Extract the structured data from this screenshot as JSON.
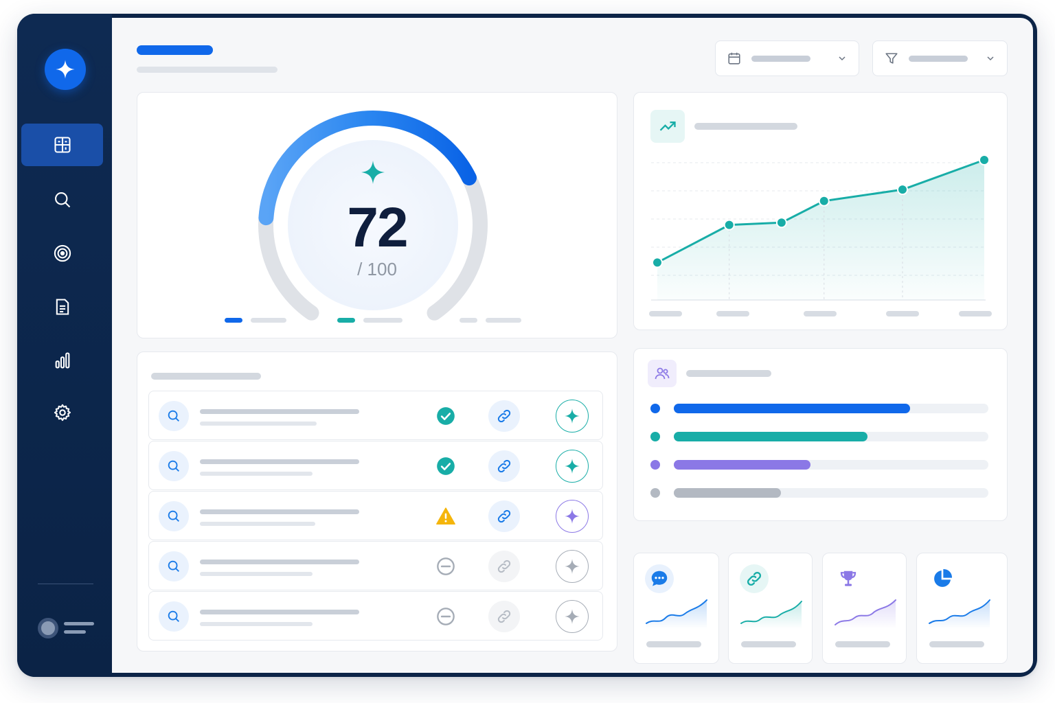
{
  "gauge": {
    "score": "72",
    "max": "/ 100",
    "value": 0.72
  },
  "colors": {
    "primary": "#1068ea",
    "teal": "#18ada7",
    "purple": "#8b78e6",
    "gray": "#b3b9c2",
    "sidebar": "#0c2447",
    "warning": "#f5b50a"
  },
  "sidebar": {
    "logo_icon": "sparkle-icon",
    "items": [
      {
        "name": "dashboard",
        "icon": "dashboard-icon",
        "active": true
      },
      {
        "name": "search",
        "icon": "search-icon",
        "active": false
      },
      {
        "name": "target",
        "icon": "target-icon",
        "active": false
      },
      {
        "name": "document",
        "icon": "document-icon",
        "active": false
      },
      {
        "name": "analytics",
        "icon": "bar-chart-icon",
        "active": false
      },
      {
        "name": "settings",
        "icon": "gear-icon",
        "active": false
      }
    ]
  },
  "header": {
    "date_filter_icon": "calendar-icon",
    "filter_icon": "funnel-icon"
  },
  "trend_chart": {
    "icon": "trending-up-icon",
    "points": [
      0.1,
      0.43,
      0.45,
      0.64,
      0.74,
      1.0
    ],
    "x_positions": [
      0,
      0.22,
      0.38,
      0.51,
      0.75,
      1.0
    ]
  },
  "breakdown": {
    "icon": "users-icon",
    "bars": [
      {
        "color": "#1068ea",
        "value": 0.75
      },
      {
        "color": "#18ada7",
        "value": 0.615
      },
      {
        "color": "#8b78e6",
        "value": 0.435
      },
      {
        "color": "#b3b9c2",
        "value": 0.34
      }
    ]
  },
  "list": {
    "rows": [
      {
        "status": "check-icon",
        "link_active": true,
        "ai_variant": "teal"
      },
      {
        "status": "check-icon",
        "link_active": true,
        "ai_variant": "teal"
      },
      {
        "status": "warning-icon",
        "link_active": true,
        "ai_variant": "purple"
      },
      {
        "status": "minus-icon",
        "link_active": false,
        "ai_variant": "gray"
      },
      {
        "status": "minus-icon",
        "link_active": false,
        "ai_variant": "gray"
      }
    ]
  },
  "mini_cards": [
    {
      "icon": "chat-icon",
      "color": "#1a7be8"
    },
    {
      "icon": "link-icon",
      "color": "#18ada7"
    },
    {
      "icon": "trophy-icon",
      "color": "#8b78e6"
    },
    {
      "icon": "pie-chart-icon",
      "color": "#1a7be8"
    }
  ]
}
